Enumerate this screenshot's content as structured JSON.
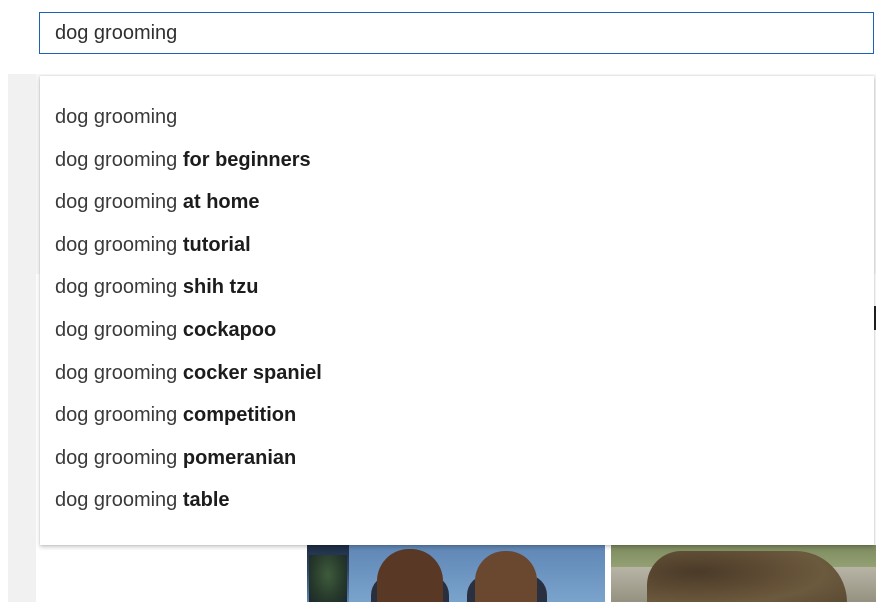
{
  "search": {
    "query": "dog grooming"
  },
  "suggestions": [
    {
      "prefix": "dog grooming",
      "completion": ""
    },
    {
      "prefix": "dog grooming ",
      "completion": "for beginners"
    },
    {
      "prefix": "dog grooming ",
      "completion": "at home"
    },
    {
      "prefix": "dog grooming ",
      "completion": "tutorial"
    },
    {
      "prefix": "dog grooming ",
      "completion": "shih tzu"
    },
    {
      "prefix": "dog grooming ",
      "completion": "cockapoo"
    },
    {
      "prefix": "dog grooming ",
      "completion": "cocker spaniel"
    },
    {
      "prefix": "dog grooming ",
      "completion": "competition"
    },
    {
      "prefix": "dog grooming ",
      "completion": "pomeranian"
    },
    {
      "prefix": "dog grooming ",
      "completion": "table"
    }
  ],
  "colors": {
    "focus_border": "#1c62b9",
    "text": "#3a3a3a",
    "completion_text": "#1c1c1c"
  }
}
